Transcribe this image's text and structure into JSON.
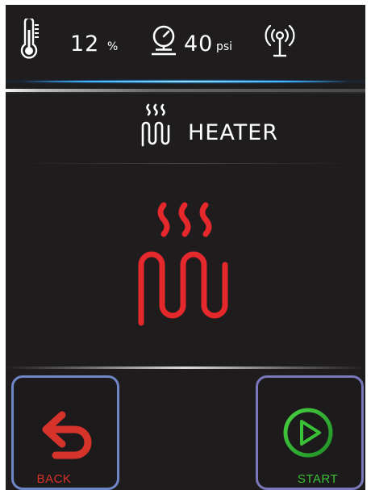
{
  "status_bar": {
    "humidity_value": "12",
    "humidity_unit": "%",
    "pressure_value": "40",
    "pressure_unit": "psi",
    "icons": [
      "thermometer-icon",
      "pressure-gauge-icon",
      "wireless-signal-icon"
    ]
  },
  "header": {
    "title": "HEATER",
    "icon": "heater-icon"
  },
  "main": {
    "icon": "heater-icon",
    "icon_color": "#e4282b"
  },
  "buttons": {
    "back_label": "BACK",
    "start_label": "START",
    "back_color": "#d6332b",
    "start_color": "#3ac138"
  },
  "colors": {
    "background": "#1e1c1d",
    "accent_glow": "#3fb6ff",
    "button_border": "#6f87c7"
  }
}
